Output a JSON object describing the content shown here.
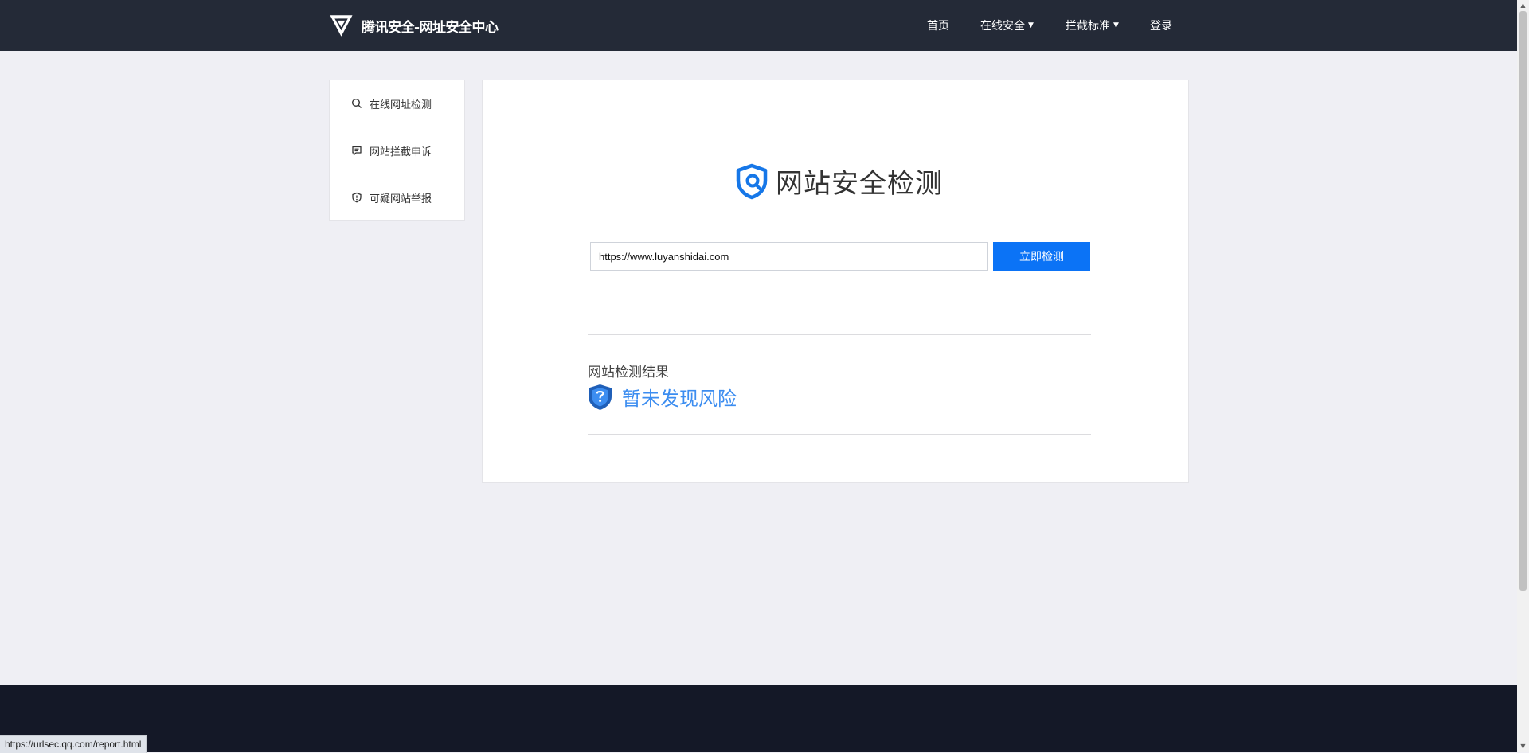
{
  "header": {
    "brand": "腾讯安全-网址安全中心",
    "nav": [
      {
        "label": "首页",
        "dropdown": false
      },
      {
        "label": "在线安全",
        "dropdown": true
      },
      {
        "label": "拦截标准",
        "dropdown": true
      },
      {
        "label": "登录",
        "dropdown": false
      }
    ]
  },
  "sidebar": {
    "items": [
      {
        "label": "在线网址检测",
        "icon": "search-icon"
      },
      {
        "label": "网站拦截申诉",
        "icon": "message-icon"
      },
      {
        "label": "可疑网站举报",
        "icon": "shield-alert-icon"
      }
    ]
  },
  "main": {
    "title": "网站安全检测",
    "url_input_value": "https://www.luyanshidai.com",
    "check_button": "立即检测",
    "result_label": "网站检测结果",
    "result_status": "暂未发现风险"
  },
  "status_bar": {
    "url": "https://urlsec.qq.com/report.html"
  },
  "colors": {
    "topbar": "#242a37",
    "accent": "#0b73f6",
    "result": "#3c8df0",
    "footer": "#141827",
    "background": "#efeff4"
  }
}
